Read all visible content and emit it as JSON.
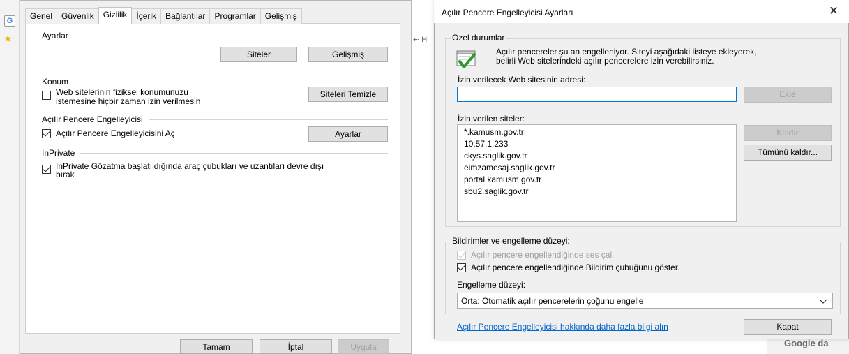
{
  "left_dialog": {
    "tabs": [
      "Genel",
      "Güvenlik",
      "Gizlilik",
      "İçerik",
      "Bağlantılar",
      "Programlar",
      "Gelişmiş"
    ],
    "settings": {
      "title": "Ayarlar",
      "sites_button": "Siteler",
      "advanced_button": "Gelişmiş"
    },
    "location": {
      "title": "Konum",
      "checkbox_line1": "Web sitelerinin fiziksel konumunuzu",
      "checkbox_line2": "istemesine hiçbir zaman izin verilmesin",
      "clear_button": "Siteleri Temizle"
    },
    "popup": {
      "title": "Açılır Pencere Engelleyicisi",
      "checkbox": "Açılır Pencere Engelleyicisini Aç",
      "settings_button": "Ayarlar"
    },
    "inprivate": {
      "title": "InPrivate",
      "checkbox_line1": "InPrivate Gözatma başlatıldığında araç çubukları ve uzantıları devre dışı",
      "checkbox_line2": "bırak"
    },
    "footer": {
      "ok": "Tamam",
      "cancel": "İptal",
      "apply": "Uygula"
    }
  },
  "right_dialog": {
    "title": "Açılır Pencere Engelleyicisi Ayarları",
    "exceptions": {
      "title": "Özel durumlar",
      "info_line1": "Açılır pencereler şu an engelleniyor. Siteyi aşağıdaki listeye ekleyerek,",
      "info_line2": "belirli Web sitelerindeki açılır pencerelere izin verebilirsiniz.",
      "address_label": "İzin verilecek Web sitesinin adresi:",
      "address_value": "",
      "add_button": "Ekle",
      "allowed_label": "İzin verilen siteler:",
      "allowed_sites": [
        "*.kamusm.gov.tr",
        "10.57.1.233",
        "ckys.saglik.gov.tr",
        "eimzamesaj.saglik.gov.tr",
        "portal.kamusm.gov.tr",
        "sbu2.saglik.gov.tr"
      ],
      "remove_button": "Kaldır",
      "remove_all_button": "Tümünü kaldır..."
    },
    "notifications": {
      "title": "Bildirimler ve engelleme düzeyi:",
      "sound_checkbox": "Açılır pencere engellendiğinde ses çal.",
      "sound_checked": true,
      "sound_enabled": false,
      "bar_checkbox": "Açılır pencere engellendiğinde Bildirim çubuğunu göster.",
      "bar_checked": true,
      "level_label": "Engelleme düzeyi:",
      "level_value": "Orta: Otomatik açılır pencerelerin çoğunu engelle"
    },
    "learn_more_link": "Açılır Pencere Engelleyicisi hakkında daha fazla bilgi alın",
    "close_button": "Kapat"
  },
  "background": {
    "letter": "G",
    "partial_text": "H",
    "bottom_text": "Google da"
  },
  "colors": {
    "dialog_bg": "#f0f0f0",
    "focus_border": "#0078d7",
    "link": "#0066cc",
    "disabled_text": "#a0a0a0"
  }
}
